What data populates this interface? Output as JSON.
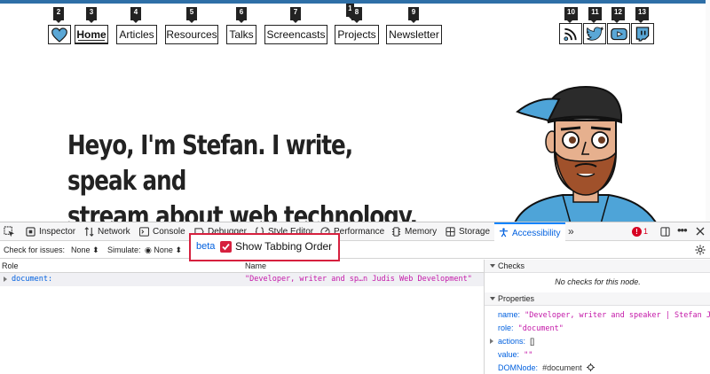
{
  "site": {
    "nav": [
      {
        "badge": "2",
        "label": ""
      },
      {
        "badge": "3",
        "label": "Home"
      },
      {
        "badge": "4",
        "label": "Articles"
      },
      {
        "badge": "5",
        "label": "Resources"
      },
      {
        "badge": "6",
        "label": "Talks"
      },
      {
        "badge": "7",
        "label": "Screencasts"
      },
      {
        "badge": "8",
        "label": "Projects"
      },
      {
        "badge": "9",
        "label": "Newsletter"
      }
    ],
    "extra_badge": "1",
    "social": [
      {
        "badge": "10",
        "icon": "rss-icon"
      },
      {
        "badge": "11",
        "icon": "twitter-icon"
      },
      {
        "badge": "12",
        "icon": "youtube-icon"
      },
      {
        "badge": "13",
        "icon": "twitch-icon"
      }
    ],
    "hero_line1": "Heyo, I'm Stefan. I write, speak and",
    "hero_line2": "stream about web technology."
  },
  "devtools": {
    "tabs": [
      {
        "label": "Inspector",
        "icon": "inspector-icon"
      },
      {
        "label": "Network",
        "icon": "network-icon"
      },
      {
        "label": "Console",
        "icon": "console-icon"
      },
      {
        "label": "Debugger",
        "icon": "debugger-icon"
      },
      {
        "label": "Style Editor",
        "icon": "style-editor-icon"
      },
      {
        "label": "Performance",
        "icon": "performance-icon"
      },
      {
        "label": "Memory",
        "icon": "memory-icon"
      },
      {
        "label": "Storage",
        "icon": "storage-icon"
      },
      {
        "label": "Accessibility",
        "icon": "accessibility-icon"
      }
    ],
    "active_tab": "Accessibility",
    "error_count": "1",
    "toolbar": {
      "check_label": "Check for issues:",
      "check_value": "None",
      "simulate_label": "Simulate:",
      "simulate_value": "None",
      "beta": "beta",
      "tabbing_label": "Show Tabbing Order",
      "tabbing_checked": true
    },
    "tree": {
      "col_role": "Role",
      "col_name": "Name",
      "rows": [
        {
          "role": "document:",
          "name": "\"Developer, writer and sp…n Judis Web Development\""
        }
      ]
    },
    "sidebar": {
      "checks_title": "Checks",
      "checks_msg": "No checks for this node.",
      "props_title": "Properties",
      "props": [
        {
          "key": "name:",
          "value": "\"Developer, writer and speaker | Stefan Judi…"
        },
        {
          "key": "role:",
          "value": "\"document\""
        },
        {
          "key": "actions:",
          "value": "[]"
        },
        {
          "key": "value:",
          "value": "\"\""
        },
        {
          "key": "DOMNode:",
          "value": "#document"
        }
      ]
    }
  },
  "colors": {
    "accent": "#0a84ff",
    "highlight": "#d6203e",
    "site_bar": "#2e6fa7"
  }
}
